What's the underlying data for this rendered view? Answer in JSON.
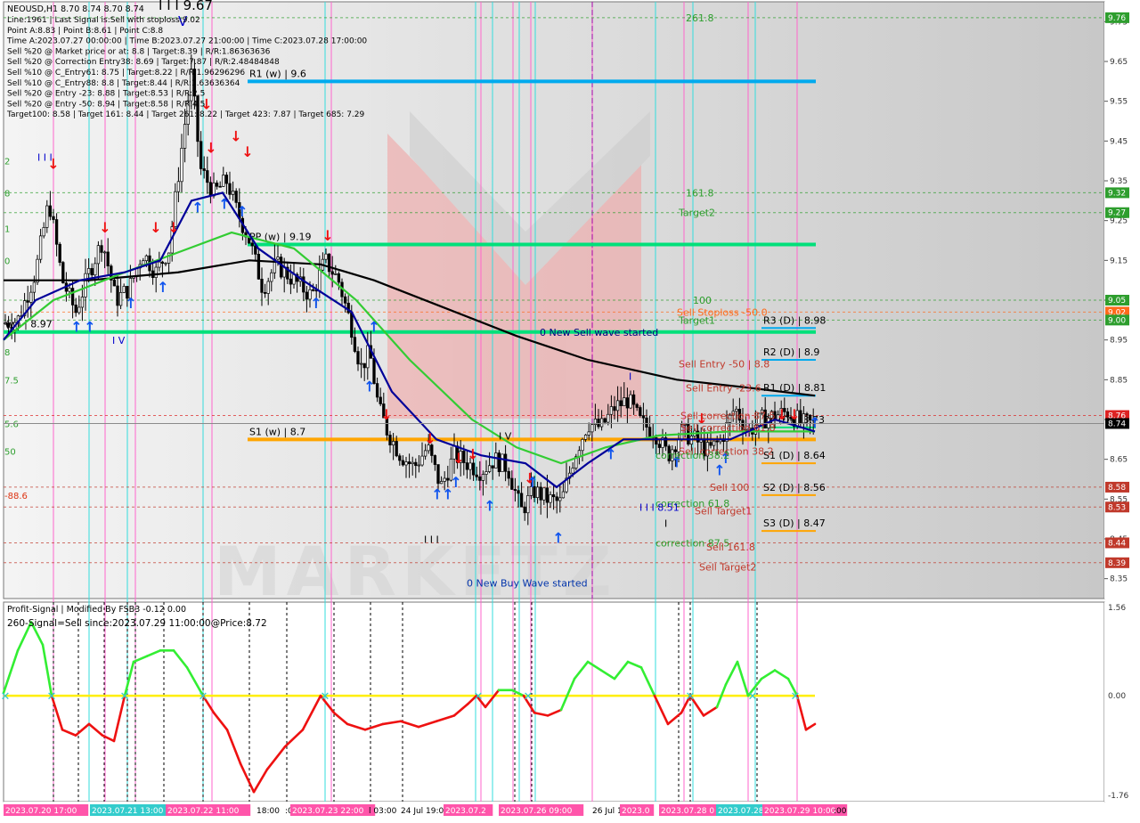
{
  "chart_data": {
    "type": "candlestick",
    "symbol_line": "NEOUSD,H1  8.70 8.74 8.70 8.74",
    "info_lines": [
      "Line:1961 | Last Signal is:Sell with stoploss:9.02",
      "Point A:8.83 | Point B:8.61 | Point C:8.8",
      "Time A:2023.07.27 00:00:00 | Time B:2023.07.27 21:00:00 | Time C:2023.07.28 17:00:00",
      "Sell %20 @ Market price or at: 8.8 | Target:8.39 | R/R:1.86363636",
      "Sell %20 @ Correction Entry38: 8.69 | Target:7.87 | R/R:2.48484848",
      "Sell %10 @ C_Entry61: 8.75 | Target:8.22 | R/R:1.96296296",
      "Sell %10 @ C_Entry88: 8.8 | Target:8.44 | R/R:1.63636364",
      "Sell %20 @ Entry -23: 8.88 | Target:8.53 | R/R:2.5",
      "Sell %20 @ Entry -50: 8.94 | Target:8.58 | R/R:4.5",
      "Target100: 8.58 | Target 161: 8.44 | Target 261: 8.22 | Target 423: 7.87 | Target 685: 7.29"
    ],
    "price_axis": {
      "ylim": [
        8.3,
        9.8
      ],
      "ticks": [
        "9.75",
        "9.65",
        "9.55",
        "9.45",
        "9.35",
        "9.25",
        "9.15",
        "9.05",
        "8.95",
        "8.85",
        "8.75",
        "8.65",
        "8.55",
        "8.45",
        "8.35"
      ],
      "markers": [
        {
          "label": "9.76",
          "value": 9.76,
          "color": "#2e9e2e"
        },
        {
          "label": "9.32",
          "value": 9.32,
          "color": "#2e9e2e"
        },
        {
          "label": "9.27",
          "value": 9.27,
          "color": "#2e9e2e"
        },
        {
          "label": "9.05",
          "value": 9.05,
          "color": "#2e9e2e"
        },
        {
          "label": "9.02",
          "value": 9.02,
          "color": "#ff6a1a"
        },
        {
          "label": "9.00",
          "value": 9.0,
          "color": "#2e9e2e"
        },
        {
          "label": "8.76",
          "value": 8.76,
          "color": "#dd2222"
        },
        {
          "label": "8.74",
          "value": 8.74,
          "color": "#000000"
        },
        {
          "label": "8.58",
          "value": 8.58,
          "color": "#c0392b"
        },
        {
          "label": "8.53",
          "value": 8.53,
          "color": "#c0392b"
        },
        {
          "label": "8.44",
          "value": 8.44,
          "color": "#c0392b"
        },
        {
          "label": "8.39",
          "value": 8.39,
          "color": "#c0392b"
        }
      ]
    },
    "levels": [
      {
        "label": "R1 (w) | 9.6",
        "value": 9.6,
        "color": "#00aaee"
      },
      {
        "label": "PP (w) | 9.19",
        "value": 9.19,
        "color": "#00e07a"
      },
      {
        "label": "S1 (w) | 8.7",
        "value": 8.7,
        "color": "#ffa500"
      },
      {
        "label": "R3 (D) | 8.98",
        "value": 8.98,
        "color": "#00aaee"
      },
      {
        "label": "R2 (D) | 8.9",
        "value": 8.9,
        "color": "#00aaee"
      },
      {
        "label": "R1 (D) | 8.81",
        "value": 8.81,
        "color": "#00aaee"
      },
      {
        "label": "PP (D) | 8.73",
        "value": 8.73,
        "color": "#00e07a"
      },
      {
        "label": "S1 (D) | 8.64",
        "value": 8.64,
        "color": "#ffa500"
      },
      {
        "label": "S2 (D) | 8.56",
        "value": 8.56,
        "color": "#ffa500"
      },
      {
        "label": "S3 (D) | 8.47",
        "value": 8.47,
        "color": "#ffa500"
      },
      {
        "label": "(w) | 8.97",
        "value": 8.97,
        "color": "#00e07a"
      }
    ],
    "fib_labels": [
      {
        "text": "261.8",
        "value": 9.76,
        "color": "#2e9e2e"
      },
      {
        "text": "161.8",
        "value": 9.32,
        "color": "#2e9e2e"
      },
      {
        "text": "Target2",
        "value": 9.27,
        "color": "#2e9e2e"
      },
      {
        "text": "100",
        "value": 9.05,
        "color": "#2e9e2e"
      },
      {
        "text": "Target1",
        "value": 9.0,
        "color": "#2e9e2e"
      },
      {
        "text": "Sell Stoploss -50.0",
        "value": 9.02,
        "color": "#ff6a1a"
      },
      {
        "text": "Sell Entry -50 | 8.8",
        "value": 8.89,
        "color": "#c0392b"
      },
      {
        "text": "Sell Entry -23.6",
        "value": 8.83,
        "color": "#c0392b"
      },
      {
        "text": "Sell correction 87.5",
        "value": 8.76,
        "color": "#c0392b"
      },
      {
        "text": "Sell correction 61.8",
        "value": 8.73,
        "color": "#c0392b"
      },
      {
        "text": "Sell correction 38.2",
        "value": 8.67,
        "color": "#c0392b"
      },
      {
        "text": "correction 38.2",
        "value": 8.66,
        "color": "#2e9e2e"
      },
      {
        "text": "Sell 100",
        "value": 8.58,
        "color": "#c0392b"
      },
      {
        "text": "correction 61.8",
        "value": 8.54,
        "color": "#2e9e2e"
      },
      {
        "text": "Sell Target1",
        "value": 8.52,
        "color": "#c0392b"
      },
      {
        "text": "correction 87.5",
        "value": 8.44,
        "color": "#2e9e2e"
      },
      {
        "text": "Sell 161.8",
        "value": 8.43,
        "color": "#c0392b"
      },
      {
        "text": "Sell Target2",
        "value": 8.38,
        "color": "#c0392b"
      }
    ],
    "wave_labels": [
      {
        "text": "0 New Sell wave started",
        "value": 8.96,
        "color": "#000080"
      },
      {
        "text": "0 New Buy Wave started",
        "value": 8.33,
        "color": "#0033aa"
      },
      {
        "text": "I I I 9.67",
        "value": 9.78,
        "color": "#000000"
      },
      {
        "text": "V",
        "value": 9.74,
        "color": "#0000cc"
      },
      {
        "text": "I I I",
        "value": 9.4,
        "color": "#0000cc"
      },
      {
        "text": "I V",
        "value": 8.94,
        "color": "#0000cc"
      },
      {
        "text": "I V",
        "value": 8.7,
        "color": "#000000"
      },
      {
        "text": "I I I",
        "value": 8.44,
        "color": "#000000"
      },
      {
        "text": "I I I 8.51",
        "value": 8.52,
        "color": "#0000cc"
      },
      {
        "text": "I",
        "value": 8.48,
        "color": "#000000"
      },
      {
        "text": "I",
        "value": 8.85,
        "color": "#0000cc"
      }
    ],
    "left_edge_labels": [
      {
        "text": "2",
        "value": 9.4
      },
      {
        "text": "8",
        "value": 9.32
      },
      {
        "text": "1",
        "value": 9.23
      },
      {
        "text": "0",
        "value": 9.15
      },
      {
        "text": "8",
        "value": 8.92
      },
      {
        "text": "7.5",
        "value": 8.85
      },
      {
        "text": "5.6",
        "value": 8.74
      },
      {
        "text": "50",
        "value": 8.67
      },
      {
        "text": "-88.6",
        "value": 8.56
      }
    ],
    "wave_price_hint": "9.67",
    "close_price": 8.74,
    "x_tick_labels": [
      "2023.07.20 17:00",
      "2023.07.21 13:00",
      "2023.07.22 11:00",
      "18:00",
      ":00",
      "2023.07.23 22:00",
      "l 03:00",
      "24 Jul 19:00",
      "2023.07.2",
      "2023.07.26 09:00",
      "26 Jul 19:00",
      "2023.0",
      "2023.07.28 0",
      "2023.07.28",
      "2023.07.29 10:00",
      ":00"
    ],
    "indicator": {
      "title": "Profit-Signal | Modified By FSB3 -0.12 0.00",
      "signal_text": "260-Signal=Sell since:2023.07.29 11:00:00@Price:8.72",
      "ylim": [
        -1.76,
        1.56
      ],
      "ticks": [
        "1.56",
        "0.00",
        "-1.76"
      ],
      "value": -0.12
    },
    "grid": true,
    "watermark": "MARKETZ"
  }
}
